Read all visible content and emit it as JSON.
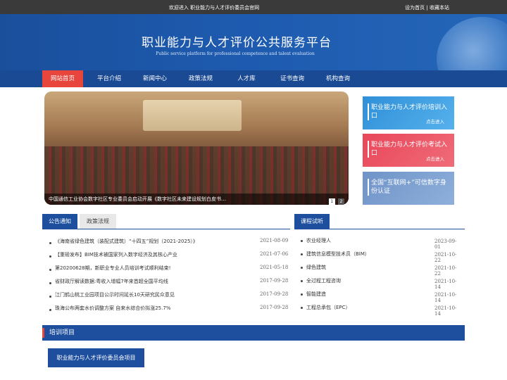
{
  "topbar": {
    "welcome": "欢迎进入 职业能力与人才评价委员会官网",
    "set_home": "设为首页",
    "separator": "|",
    "bookmark": "收藏本站"
  },
  "header": {
    "title": "职业能力与人才评价公共服务平台",
    "subtitle": "Public service platform for professional competence and talent evaluation"
  },
  "nav": {
    "items": [
      "网站首页",
      "平台介绍",
      "新闻中心",
      "政策法规",
      "人才库",
      "证书查询",
      "机构查询"
    ],
    "active_index": 0
  },
  "banner": {
    "caption": "中国通信工业协会数字社区专业委员会启动开展《数字社区未来建设规划白皮书…",
    "pages": [
      "1",
      "2"
    ],
    "current_page": "1"
  },
  "side_entries": [
    {
      "label": "职业能力与人才评价培训入口",
      "sub": "点击进入",
      "color": "#2f8fd8"
    },
    {
      "label": "职业能力与人才评价考试入口",
      "sub": "点击进入",
      "color": "#e8475a"
    },
    {
      "label": "全国“互联网+”可信数字身份认证",
      "sub": "",
      "color": "#6f93c8"
    }
  ],
  "notice_tabs": [
    "公告通知",
    "政策法规"
  ],
  "notices": [
    {
      "title": "《海南省绿色建筑（装配式建筑）“十四五”规划（2021-2025）》",
      "date": "2021-08-09"
    },
    {
      "title": "【重磅发布】BIM技术被国家列入数字经济及其核心产业",
      "date": "2021-07-06"
    },
    {
      "title": "第20200628期，新职业专业人员培训考试顺利结束!",
      "date": "2021-05-18"
    },
    {
      "title": "省财政厅解读数据:粤收入增幅7年来首超全国平均线",
      "date": "2017-09-28"
    },
    {
      "title": "江门鹤山桃工业园项目公示时间延长10天研究民众意见",
      "date": "2017-09-28"
    },
    {
      "title": "珠海公布两套水价调整方案 自来水综合价拟涨25.7%",
      "date": "2017-09-28"
    }
  ],
  "course_tab": "课程试听",
  "courses": [
    {
      "title": "农业经理人",
      "date": "2023-09-01"
    },
    {
      "title": "建筑信息模型技术员（BIM）",
      "date": "2021-10-22"
    },
    {
      "title": "绿色建筑",
      "date": "2021-10-22"
    },
    {
      "title": "全过程工程咨询",
      "date": "2021-10-14"
    },
    {
      "title": "智能建造",
      "date": "2021-10-14"
    },
    {
      "title": "工程总承包（EPC）",
      "date": "2021-10-14"
    }
  ],
  "training": {
    "heading": "培训项目",
    "projects": [
      "职业能力与人才评价委员会项目"
    ]
  }
}
